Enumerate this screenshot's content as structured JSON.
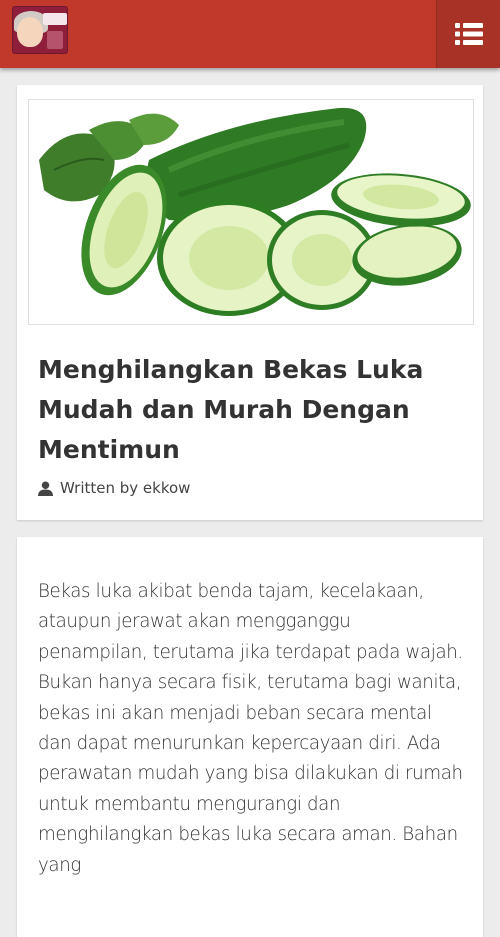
{
  "header": {
    "logo_icon": "site-logo",
    "menu_icon": "list-menu-icon",
    "colors": {
      "bar": "#c0392b",
      "menu_button": "#a93226"
    }
  },
  "article": {
    "image_icon": "cucumber-photo",
    "title": "Menghilangkan Bekas Luka Mudah dan Murah Dengan Mentimun",
    "author_icon": "user-icon",
    "author_line": "Written by ekkow"
  },
  "content": {
    "paragraph": "Bekas luka akibat benda tajam, kecelakaan, ataupun jerawat akan mengganggu penampilan, terutama jika terdapat pada wajah. Bukan hanya secara fisik, terutama bagi wanita, bekas ini akan menjadi beban secara mental dan dapat menurunkan kepercayaan diri. Ada perawatan mudah yang bisa dilakukan di rumah untuk membantu mengurangi dan menghilangkan bekas luka secara aman. Bahan yang"
  }
}
